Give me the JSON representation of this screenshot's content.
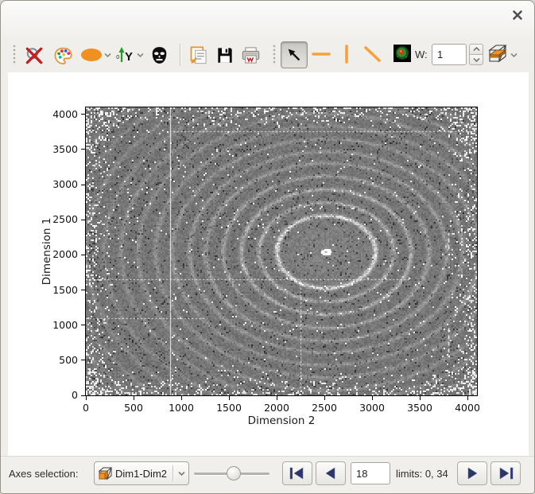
{
  "window": {
    "close_icon": "x-close"
  },
  "toolbar": {
    "w_label": "W:",
    "w_value": "1",
    "tools": [
      {
        "name": "zoom-reset",
        "icon": "magnifier-red-x"
      },
      {
        "name": "colormap",
        "icon": "palette"
      },
      {
        "name": "ellipse-brush",
        "icon": "orange-ellipse",
        "has_dropdown": true
      },
      {
        "name": "y-axis-direction",
        "icon": "y-axis-green-arrow",
        "has_dropdown": true
      },
      {
        "name": "mask",
        "icon": "mask-face"
      },
      {
        "name": "copy",
        "icon": "clipboard-copy"
      },
      {
        "name": "save",
        "icon": "floppy-disk"
      },
      {
        "name": "print",
        "icon": "printer"
      },
      {
        "name": "pointer-select",
        "icon": "arrow-cursor",
        "active": true
      },
      {
        "name": "horizontal-line",
        "icon": "orange-hline"
      },
      {
        "name": "vertical-line",
        "icon": "orange-vline"
      },
      {
        "name": "diagonal-line",
        "icon": "orange-dline"
      },
      {
        "name": "image-view",
        "icon": "heatmap-thumbnail"
      },
      {
        "name": "width-spinbox",
        "value": "1"
      },
      {
        "name": "slice-cube",
        "icon": "cube-orange-slice",
        "has_dropdown": true
      }
    ]
  },
  "plot": {
    "xlabel": "Dimension 2",
    "ylabel": "Dimension 1",
    "x_ticks": [
      0,
      500,
      1000,
      1500,
      2000,
      2500,
      3000,
      3500,
      4000
    ],
    "y_ticks": [
      0,
      500,
      1000,
      1500,
      2000,
      2500,
      3000,
      3500,
      4000
    ],
    "x_max": 4100,
    "y_max": 4100,
    "image": {
      "description": "powder-diffraction-ring-pattern",
      "ring_center": [
        2520,
        2040
      ],
      "ring_radii": [
        517,
        705,
        890,
        1080,
        1265,
        1432,
        1610,
        1790,
        1972,
        2150,
        2332,
        2520,
        2705,
        2890,
        3080,
        3270
      ],
      "ring_amps": [
        88,
        42,
        47,
        38,
        34,
        30,
        28,
        26,
        24,
        22,
        20,
        19,
        18,
        17,
        16,
        15
      ],
      "base_gray": 117,
      "overlays": [
        {
          "type": "vline",
          "x": 880,
          "y1": 0,
          "y2": 4100,
          "dash": "solid"
        },
        {
          "type": "hline",
          "y": 1650,
          "x1": 0,
          "x2": 3400,
          "dash": "dotted"
        },
        {
          "type": "hline",
          "y": 1100,
          "x1": 0,
          "x2": 1270,
          "dash": "dotted"
        },
        {
          "type": "hline",
          "y": 3760,
          "x1": 880,
          "x2": 4100,
          "dash": "dotted"
        },
        {
          "type": "vline",
          "x": 2250,
          "y1": 0,
          "y2": 1650,
          "dash": "dotted"
        },
        {
          "type": "vline",
          "x": 3800,
          "y1": 2080,
          "y2": 2310,
          "dash": "dashed"
        },
        {
          "type": "vline",
          "x": 3800,
          "y1": 610,
          "y2": 985,
          "dash": "dashed"
        }
      ]
    }
  },
  "bottom_bar": {
    "axes_selection_label": "Axes selection:",
    "axes_combo_value": "Dim1-Dim2",
    "slider": {
      "min": 0,
      "max": 34,
      "value": 18
    },
    "frame_field_value": "18",
    "limits_text": "limits: 0, 34",
    "nav_icons": [
      "first-frame",
      "previous-frame",
      "next-frame",
      "last-frame"
    ]
  },
  "colors": {
    "accent_orange": "#f49125",
    "nav_arrow_navy": "#2c3768",
    "window_bg": "#efeeea",
    "plot_bg": "#ffffff"
  }
}
